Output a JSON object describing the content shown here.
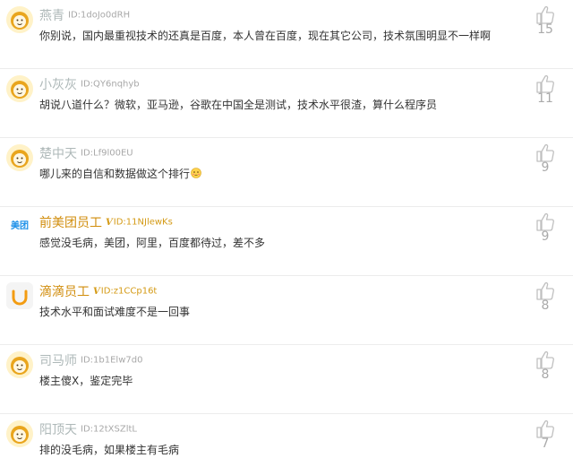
{
  "comments": [
    {
      "avatar_icon": "lion-avatar-icon",
      "username": "燕青",
      "user_id": "ID:1doJo0dRH",
      "content": "你别说，国内最重视技术的还真是百度，本人曾在百度，现在其它公司，技术氛围明显不一样啊",
      "likes": "15"
    },
    {
      "avatar_icon": "lion-avatar-icon",
      "username": "小灰灰",
      "user_id": "ID:QY6nqhyb",
      "content": "胡说八道什么？微软，亚马逊，谷歌在中国全是测试，技术水平很渣，算什么程序员",
      "likes": "11"
    },
    {
      "avatar_icon": "lion-avatar-icon",
      "username": "楚中天",
      "user_id": "ID:Lf9l00EU",
      "content": "哪儿来的自信和数据做这个排行",
      "has_emoji": true,
      "emoji_icon": "embarrassed-emoji-icon",
      "likes": "9"
    },
    {
      "avatar_icon": "meituan-logo-icon",
      "avatar_text": "美团",
      "username": "前美团员工",
      "verified": true,
      "verified_mark": "V",
      "user_id": "ID:11NJlewKs",
      "content": "感觉没毛病，美团，阿里，百度都待过，差不多",
      "likes": "9"
    },
    {
      "avatar_icon": "didi-logo-icon",
      "username": "滴滴员工",
      "verified": true,
      "verified_mark": "V",
      "user_id": "ID:z1CCp16t",
      "content": "技术水平和面试难度不是一回事",
      "likes": "8"
    },
    {
      "avatar_icon": "lion-avatar-icon",
      "username": "司马师",
      "user_id": "ID:1b1Elw7d0",
      "content": "楼主傻X，鉴定完毕",
      "likes": "8"
    },
    {
      "avatar_icon": "lion-avatar-icon",
      "username": "阳顶天",
      "user_id": "ID:12tXSZltL",
      "content": "排的没毛病，如果楼主有毛病",
      "likes": "7"
    }
  ],
  "colors": {
    "username_default": "#aeb8b8",
    "username_verified": "#d18d0c",
    "verified_badge": "#d49a15",
    "meituan_blue": "#1b8fe8",
    "didi_orange": "#f39c12",
    "like_icon": "#c0c0c0"
  }
}
